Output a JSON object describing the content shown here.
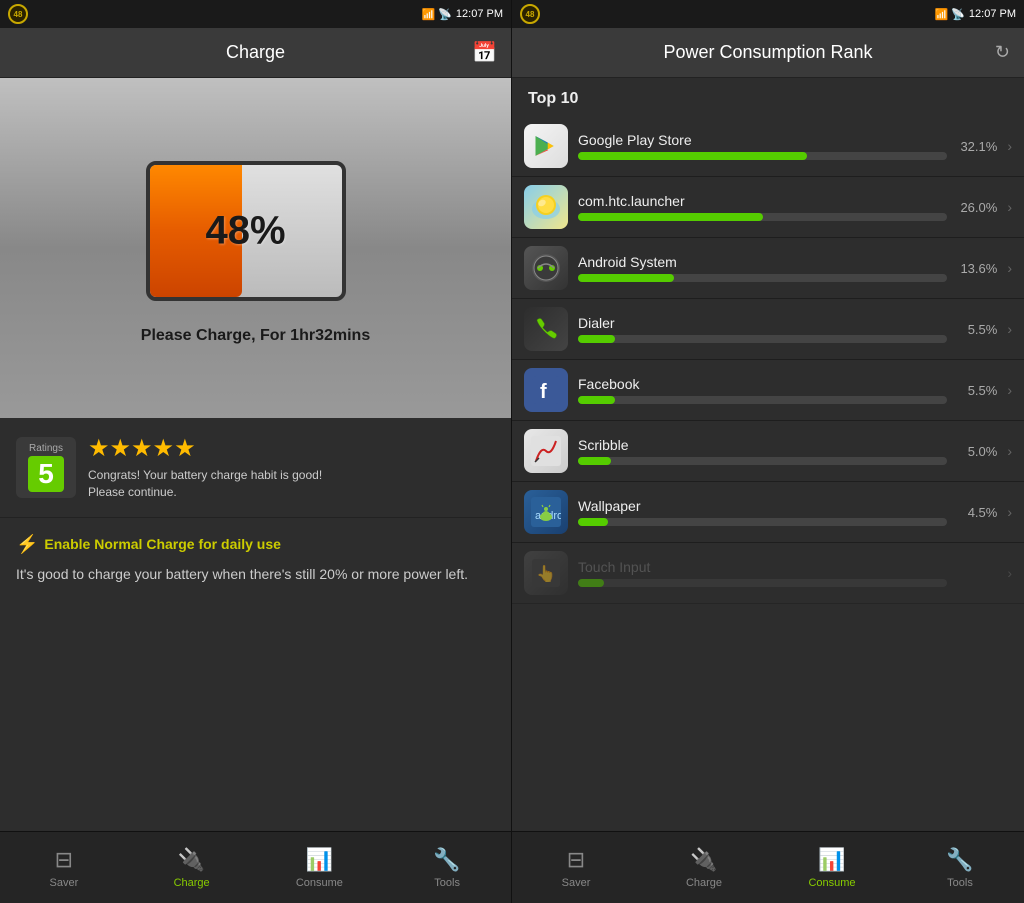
{
  "left": {
    "status": {
      "battery_num": "48",
      "time": "12:07 PM"
    },
    "header": {
      "title": "Charge",
      "icon": "📅"
    },
    "battery": {
      "percent": "48%",
      "fill_width": "48%",
      "message": "Please Charge, For 1hr32mins"
    },
    "ratings": {
      "label": "Ratings",
      "score": "5",
      "stars": "★★★★★",
      "text": "Congrats! Your battery charge habit is good!\nPlease continue."
    },
    "tip": {
      "icon": "⚡",
      "title": "Enable Normal Charge for daily use",
      "text": "It's good to charge your battery when there's still 20% or more power left."
    },
    "nav": [
      {
        "id": "saver",
        "icon": "🔋",
        "label": "Saver",
        "active": false
      },
      {
        "id": "charge",
        "icon": "🔌",
        "label": "Charge",
        "active": true
      },
      {
        "id": "consume",
        "icon": "📊",
        "label": "Consume",
        "active": false
      },
      {
        "id": "tools",
        "icon": "🔧",
        "label": "Tools",
        "active": false
      }
    ]
  },
  "right": {
    "status": {
      "battery_num": "48",
      "time": "12:07 PM"
    },
    "header": {
      "title": "Power Consumption Rank"
    },
    "top10_label": "Top 10",
    "apps": [
      {
        "name": "Google Play Store",
        "percent": "32.1%",
        "bar_width": "62%",
        "icon_type": "playstore",
        "icon_char": "▶"
      },
      {
        "name": "com.htc.launcher",
        "percent": "26.0%",
        "bar_width": "50%",
        "icon_type": "launcher",
        "icon_char": "☁"
      },
      {
        "name": "Android System",
        "percent": "13.6%",
        "bar_width": "26%",
        "icon_type": "android",
        "icon_char": "⚙"
      },
      {
        "name": "Dialer",
        "percent": "5.5%",
        "bar_width": "10%",
        "icon_type": "dialer",
        "icon_char": "📞"
      },
      {
        "name": "Facebook",
        "percent": "5.5%",
        "bar_width": "10%",
        "icon_type": "facebook",
        "icon_char": "f"
      },
      {
        "name": "Scribble",
        "percent": "5.0%",
        "bar_width": "9%",
        "icon_type": "scribble",
        "icon_char": "✏"
      },
      {
        "name": "Wallpaper",
        "percent": "4.5%",
        "bar_width": "8%",
        "icon_type": "wallpaper",
        "icon_char": "🤖"
      },
      {
        "name": "Touch Input",
        "percent": "...",
        "bar_width": "7%",
        "icon_type": "android",
        "icon_char": "👆"
      }
    ],
    "nav": [
      {
        "id": "saver",
        "icon": "🔋",
        "label": "Saver",
        "active": false
      },
      {
        "id": "charge",
        "icon": "🔌",
        "label": "Charge",
        "active": false
      },
      {
        "id": "consume",
        "icon": "📊",
        "label": "Consume",
        "active": true
      },
      {
        "id": "tools",
        "icon": "🔧",
        "label": "Tools",
        "active": false
      }
    ]
  }
}
